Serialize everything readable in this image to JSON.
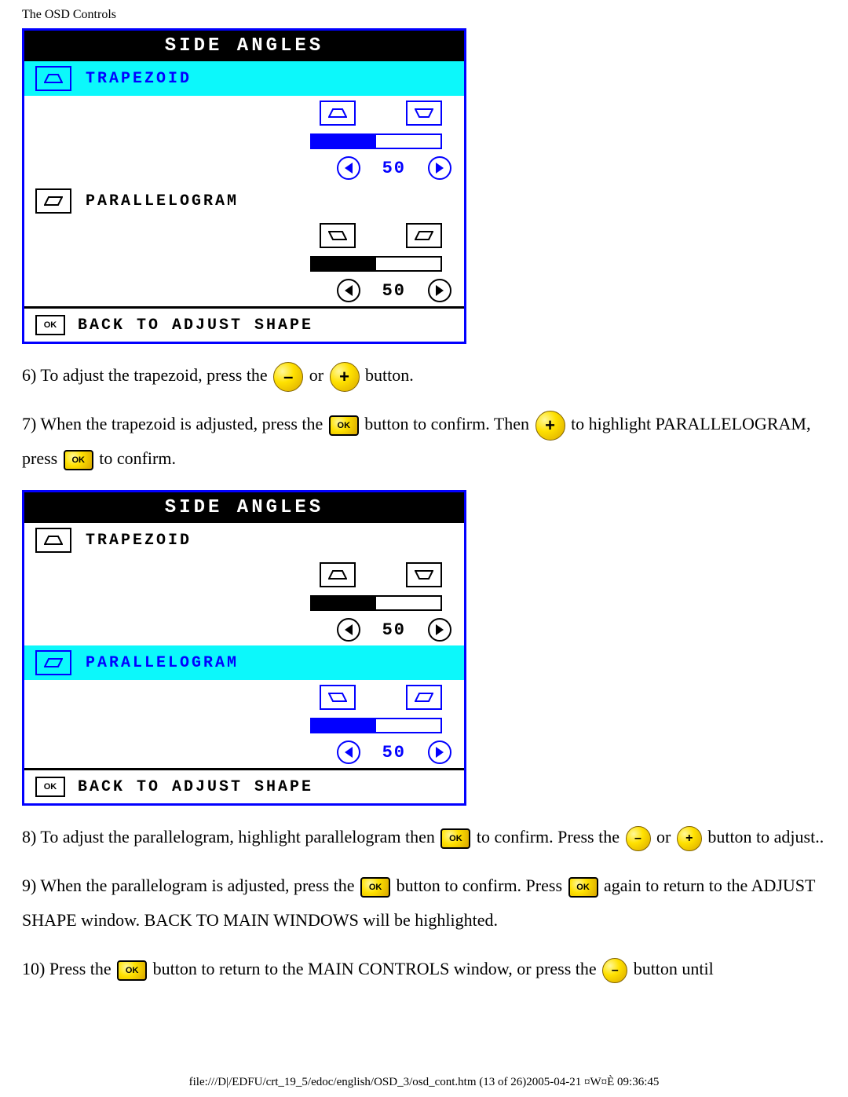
{
  "page_title": "The OSD Controls",
  "osd": {
    "title": "SIDE ANGLES",
    "row1_label": "TRAPEZOID",
    "row1_value": "50",
    "row2_label": "PARALLELOGRAM",
    "row2_value": "50",
    "footer_label": "BACK TO ADJUST SHAPE",
    "ok_label": "OK"
  },
  "buttons": {
    "minus": "–",
    "plus": "+",
    "ok": "OK"
  },
  "instr": {
    "p6_a": "6) To adjust the trapezoid, press the ",
    "p6_b": " or ",
    "p6_c": " button.",
    "p7_a": "7) When the trapezoid is adjusted, press the ",
    "p7_b": " button to confirm. Then ",
    "p7_c": " to highlight PARALLELOGRAM, press ",
    "p7_d": " to confirm.",
    "p8_a": "8) To adjust the parallelogram, highlight parallelogram then ",
    "p8_b": " to confirm. Press the ",
    "p8_c": " or ",
    "p8_d": " button to adjust..",
    "p9_a": "9) When the parallelogram is adjusted, press the ",
    "p9_b": " button to confirm. Press ",
    "p9_c": " again to return to the ADJUST SHAPE window. BACK TO MAIN WINDOWS will be highlighted.",
    "p10_a": "10) Press the ",
    "p10_b": " button to return to the MAIN CONTROLS window, or press the ",
    "p10_c": " button until"
  },
  "footer_text": "file:///D|/EDFU/crt_19_5/edoc/english/OSD_3/osd_cont.htm (13 of 26)2005-04-21 ¤W¤È 09:36:45"
}
